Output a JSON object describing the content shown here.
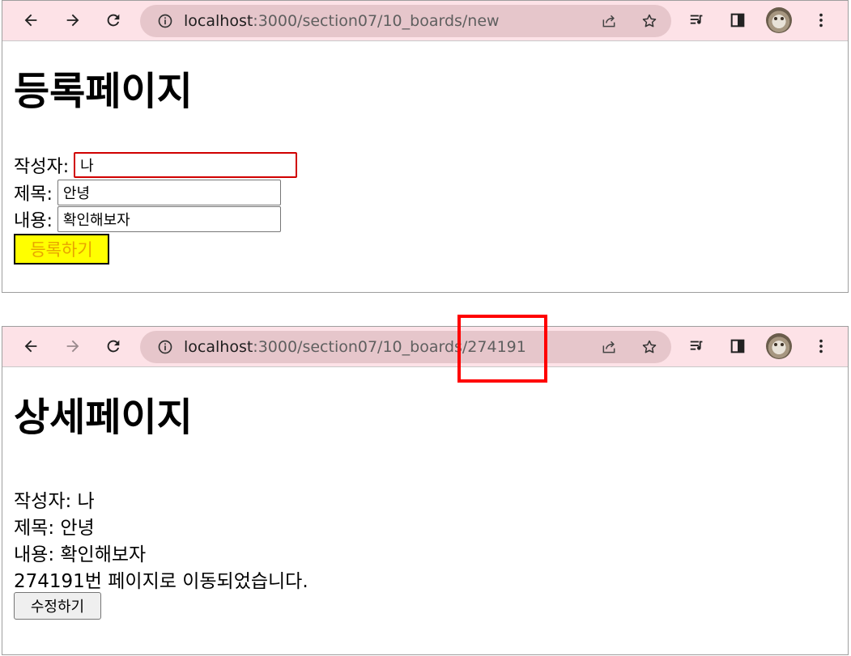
{
  "top_window": {
    "url_host": "localhost",
    "url_path": ":3000/section07/10_boards/new",
    "page_title": "등록페이지",
    "form": {
      "writer_label": "작성자:",
      "writer_value": "나",
      "title_label": "제목:",
      "title_value": "안녕",
      "content_label": "내용:",
      "content_value": "확인해보자",
      "submit_label": "등록하기"
    }
  },
  "bottom_window": {
    "url_host": "localhost",
    "url_path": ":3000/section07/10_boards/274191",
    "page_title": "상세페이지",
    "writer_line": "작성자: 나",
    "title_line": "제목: 안녕",
    "content_line": "내용: 확인해보자",
    "moved_message": "274191번 페이지로 이동되었습니다.",
    "edit_label": "수정하기"
  },
  "colors": {
    "toolbar_bg": "#fde2e7",
    "omnibox_bg": "#e6c6cb",
    "highlight_red": "#ff0000",
    "submit_bg": "#ffff00",
    "submit_text": "#e8a400"
  },
  "icons": {
    "back": "arrow-left-icon",
    "forward": "arrow-right-icon",
    "reload": "reload-icon",
    "site_info": "info-circle-icon",
    "share": "share-icon",
    "bookmark": "star-icon",
    "media": "media-queue-icon",
    "side_panel": "side-panel-icon",
    "menu": "kebab-menu-icon"
  }
}
